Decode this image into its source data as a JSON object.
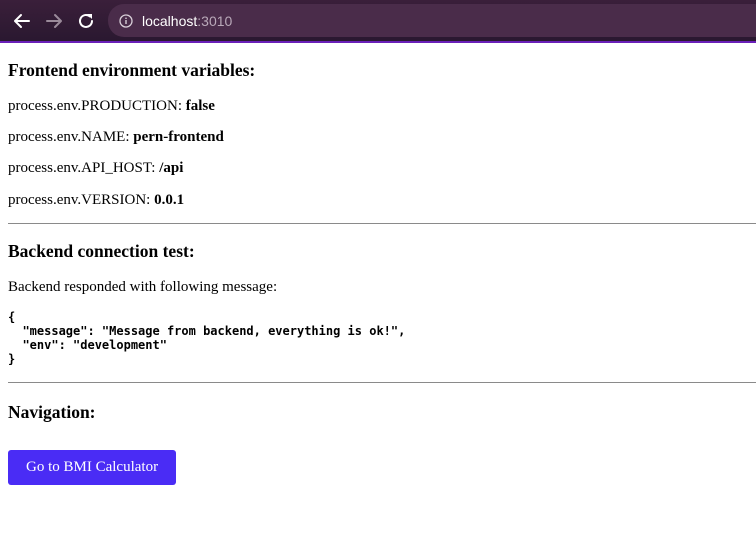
{
  "browser": {
    "url_host": "localhost",
    "url_port": ":3010"
  },
  "frontend": {
    "heading": "Frontend environment variables:",
    "vars": [
      {
        "key": "process.env.PRODUCTION: ",
        "value": "false"
      },
      {
        "key": "process.env.NAME: ",
        "value": "pern-frontend"
      },
      {
        "key": "process.env.API_HOST: ",
        "value": "/api"
      },
      {
        "key": "process.env.VERSION: ",
        "value": "0.0.1"
      }
    ]
  },
  "backend": {
    "heading": "Backend connection test:",
    "status_text": "Backend responded with following message:",
    "response_json": "{\n  \"message\": \"Message from backend, everything is ok!\",\n  \"env\": \"development\"\n}"
  },
  "navigation": {
    "heading": "Navigation:",
    "button_label": "Go to BMI Calculator"
  }
}
